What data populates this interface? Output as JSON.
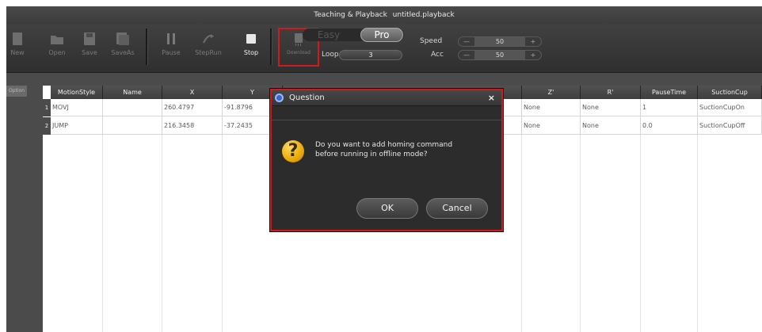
{
  "window": {
    "title": "Teaching & Playback",
    "filename": "untitled.playback"
  },
  "toolbar": {
    "buttons": [
      {
        "label": "New",
        "icon": "new-file-icon"
      },
      {
        "label": "Open",
        "icon": "folder-open-icon"
      },
      {
        "label": "Save",
        "icon": "save-icon"
      },
      {
        "label": "SaveAs",
        "icon": "save-as-icon"
      },
      {
        "label": "Pause",
        "icon": "pause-icon"
      },
      {
        "label": "StepRun",
        "icon": "step-run-icon"
      },
      {
        "label": "Stop",
        "icon": "stop-icon"
      },
      {
        "label": "Download",
        "icon": "download-icon"
      }
    ],
    "mode": {
      "easy": "Easy",
      "pro": "Pro",
      "selected": "Pro"
    },
    "loop": {
      "label": "Loop",
      "value": "3"
    },
    "speed": {
      "label": "Speed",
      "minus": "—",
      "value": "50",
      "plus": "+"
    },
    "acc": {
      "label": "Acc",
      "minus": "—",
      "value": "50",
      "plus": "+"
    }
  },
  "left_panel": {
    "tab_label": "Option"
  },
  "grid": {
    "columns": [
      "MotionStyle",
      "Name",
      "X",
      "Y",
      "Z'",
      "R'",
      "PauseTime",
      "SuctionCup"
    ],
    "rows": [
      {
        "num": "1",
        "MotionStyle": "MOVJ",
        "Name": "",
        "X": "260.4797",
        "Y": "-91.8796",
        "Z'": "None",
        "R'": "None",
        "PauseTime": "1",
        "SuctionCup": "SuctionCupOn"
      },
      {
        "num": "2",
        "MotionStyle": "JUMP",
        "Name": "",
        "X": "216.3458",
        "Y": "-37.2435",
        "Z'": "None",
        "R'": "None",
        "PauseTime": "0.0",
        "SuctionCup": "SuctionCupOff"
      }
    ]
  },
  "dialog": {
    "title": "Question",
    "close": "×",
    "message_line1": "Do you want to add homing command",
    "message_line2": "before running in offline mode?",
    "ok": "OK",
    "cancel": "Cancel"
  },
  "colors": {
    "highlight": "#d11b1b",
    "toolbar": "#3a3a3a",
    "dialog_bg": "#2c2c2c"
  }
}
